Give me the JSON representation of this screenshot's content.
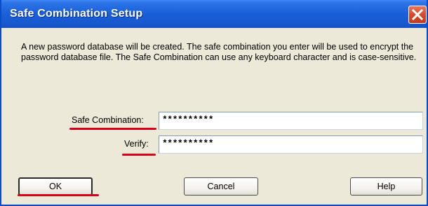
{
  "window": {
    "title": "Safe Combination Setup",
    "close_label": "×"
  },
  "description": "A new password database will be created. The safe combination you enter will be used to encrypt the password database file. The Safe Combination can use any keyboard character and is case-sensitive.",
  "fields": {
    "safe_combination": {
      "label": "Safe Combination:",
      "value": "**********"
    },
    "verify": {
      "label": "Verify:",
      "value": "**********"
    }
  },
  "buttons": {
    "ok": "OK",
    "cancel": "Cancel",
    "help": "Help"
  },
  "colors": {
    "titlebar": "#1a5fd8",
    "dialog_background": "#ece9d8",
    "close_button": "#d8482a",
    "annotation_underline": "#d9001a"
  },
  "icons": {
    "close": "close-icon"
  }
}
